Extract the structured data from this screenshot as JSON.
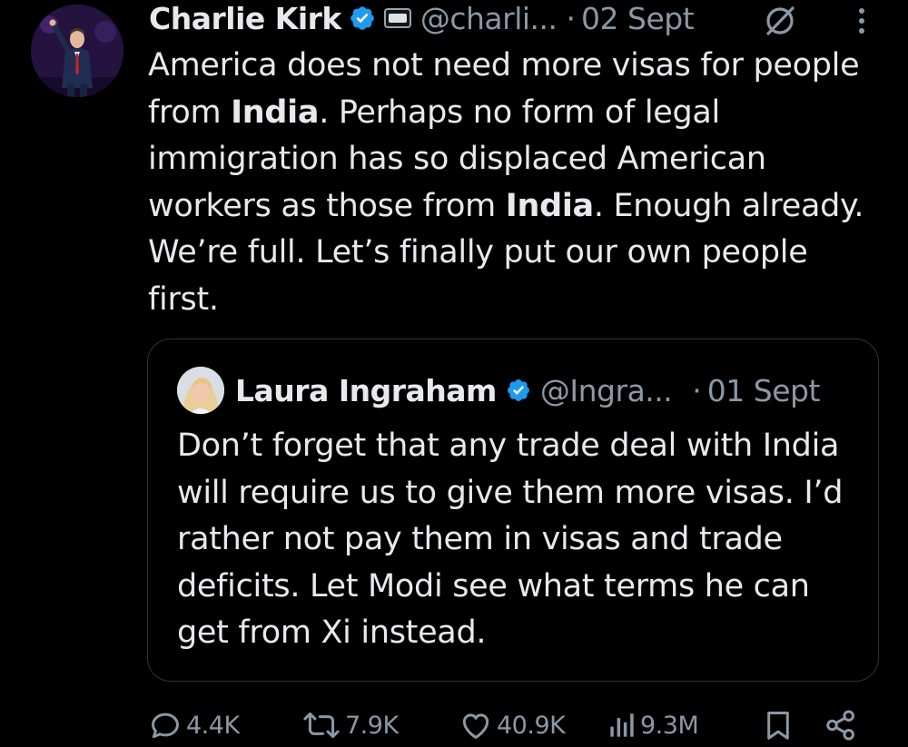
{
  "tweet": {
    "author_name": "Charlie Kirk",
    "handle": "@charli...",
    "separator": "·",
    "date": "02 Sept",
    "body_lines": [
      {
        "parts": [
          {
            "text": "America does not need more visas for people",
            "bold": false
          }
        ]
      },
      {
        "parts": [
          {
            "text": "from ",
            "bold": false
          },
          {
            "text": "India",
            "bold": true
          },
          {
            "text": ". Perhaps no form of legal",
            "bold": false
          }
        ]
      },
      {
        "parts": [
          {
            "text": "immigration has so displaced American",
            "bold": false
          }
        ]
      },
      {
        "parts": [
          {
            "text": "workers as those from ",
            "bold": false
          },
          {
            "text": "India",
            "bold": true
          },
          {
            "text": ". Enough already.",
            "bold": false
          }
        ]
      },
      {
        "parts": [
          {
            "text": "We’re full. Let’s finally put our own people",
            "bold": false
          }
        ]
      },
      {
        "parts": [
          {
            "text": "first.",
            "bold": false
          }
        ]
      }
    ]
  },
  "quoted_tweet": {
    "author_name": "Laura Ingraham",
    "handle": "@Ingra...",
    "separator": "·",
    "date": "01 Sept",
    "body_lines": [
      "Don’t forget that any trade deal with India",
      "will require us to give them more visas.  I’d",
      "rather not pay them in visas and trade",
      "deficits. Let Modi see what terms he can",
      "get from Xi instead."
    ]
  },
  "actions": {
    "replies": "4.4K",
    "reposts": "7.9K",
    "likes": "40.9K",
    "views": "9.3M"
  },
  "icons": {
    "verified": "verified-badge-icon",
    "affiliation": "affiliation-badge-icon",
    "grok": "grok-icon",
    "more": "more-options-icon",
    "reply": "reply-icon",
    "repost": "repost-icon",
    "like": "like-icon",
    "views": "views-icon",
    "bookmark": "bookmark-icon",
    "share": "share-icon"
  },
  "colors": {
    "background": "#000000",
    "text": "#e7e9ea",
    "muted": "#8b98a5",
    "verified_blue": "#1d9bf0",
    "border": "#2f3336"
  }
}
